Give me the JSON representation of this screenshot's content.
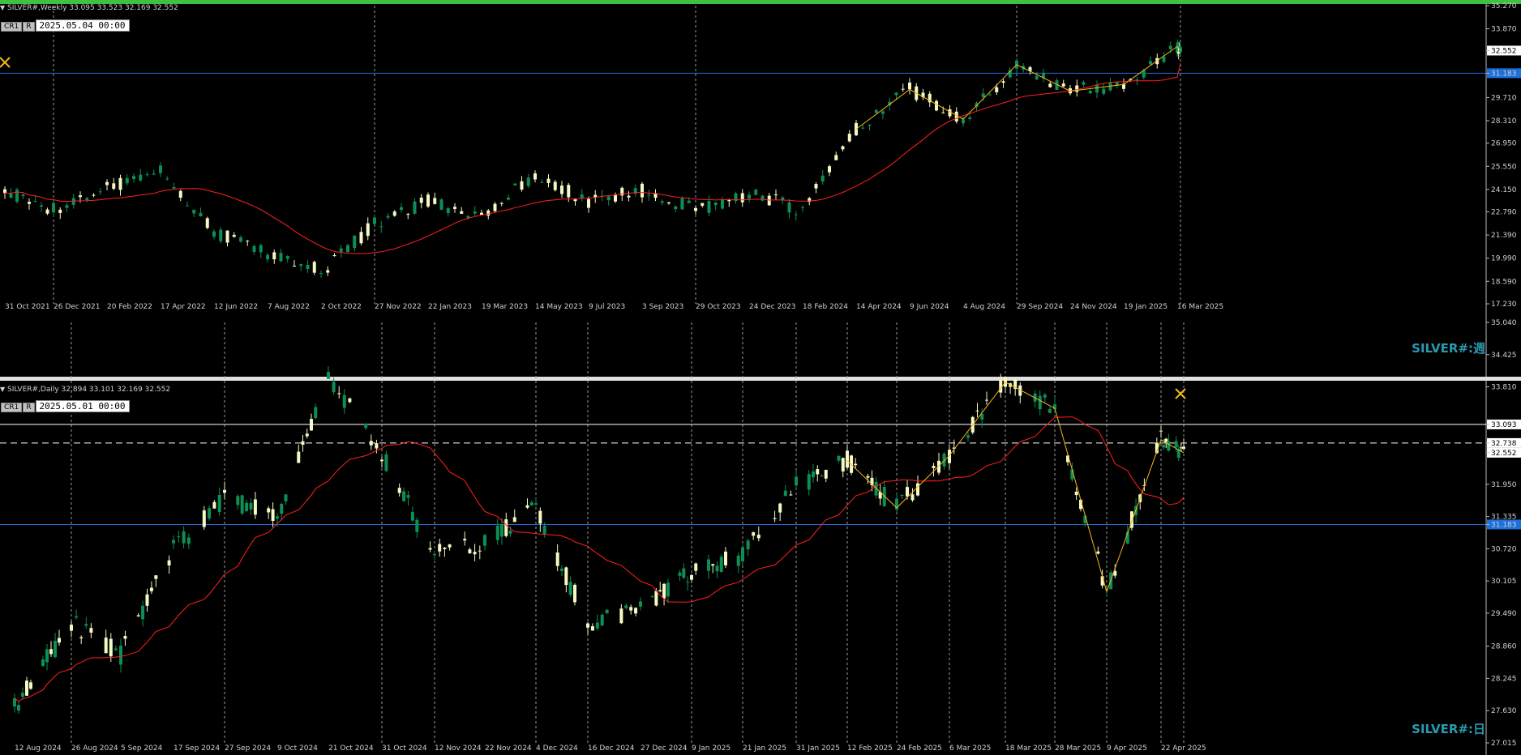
{
  "colors": {
    "background": "#000000",
    "bull": "#0b8f55",
    "bear": "#f4f9c4",
    "ma": "#ff2020",
    "zigzag": "#f2b81a",
    "hline_blue": "#1e6fd9",
    "hline_white": "#ffffff",
    "grid": "#9a9a9a",
    "axis_text": "#d0d0d0",
    "price_tag_blue": "#1e6fd9",
    "watermark": "#2a9bb0",
    "top_bar": "#40c040"
  },
  "weekly": {
    "header": "SILVER#,Weekly  33.095 33.523 32.169 32.552",
    "btn_cr1": "CR1",
    "btn_r": "R",
    "date_box": "2025.05.04 00:00",
    "watermark": "SILVER#:週",
    "price_labels": [
      "35.270",
      "33.870",
      "32.552",
      "31.183",
      "29.710",
      "28.310",
      "26.950",
      "25.550",
      "24.150",
      "22.790",
      "21.390",
      "19.990",
      "18.590",
      "17.230"
    ],
    "date_labels": [
      "31 Oct 2021",
      "26 Dec 2021",
      "20 Feb 2022",
      "17 Apr 2022",
      "12 Jun 2022",
      "7 Aug 2022",
      "2 Oct 2022",
      "27 Nov 2022",
      "22 Jan 2023",
      "19 Mar 2023",
      "14 May 2023",
      "9 Jul 2023",
      "3 Sep 2023",
      "29 Oct 2023",
      "24 Dec 2023",
      "18 Feb 2024",
      "14 Apr 2024",
      "9 Jun 2024",
      "4 Aug 2024",
      "29 Sep 2024",
      "24 Nov 2024",
      "19 Jan 2025",
      "16 Mar 2025"
    ]
  },
  "daily": {
    "header": "SILVER#,Daily  32.894 33.101 32.169 32.552",
    "btn_cr1": "CR1",
    "btn_r": "R",
    "date_box": "2025.05.01 00:00",
    "watermark": "SILVER#:日",
    "price_labels": [
      "35.040",
      "34.425",
      "33.810",
      "33.093",
      "32.738",
      "32.552",
      "31.950",
      "31.335",
      "31.183",
      "30.720",
      "30.105",
      "29.490",
      "28.860",
      "28.245",
      "27.630",
      "27.015"
    ],
    "date_labels": [
      "12 Aug 2024",
      "26 Aug 2024",
      "5 Sep 2024",
      "17 Sep 2024",
      "27 Sep 2024",
      "9 Oct 2024",
      "21 Oct 2024",
      "31 Oct 2024",
      "12 Nov 2024",
      "22 Nov 2024",
      "4 Dec 2024",
      "16 Dec 2024",
      "27 Dec 2024",
      "9 Jan 2025",
      "21 Jan 2025",
      "31 Jan 2025",
      "12 Feb 2025",
      "24 Feb 2025",
      "6 Mar 2025",
      "18 Mar 2025",
      "28 Mar 2025",
      "9 Apr 2025",
      "22 Apr 2025"
    ]
  },
  "chart_data": [
    {
      "type": "candlestick",
      "title": "SILVER#,Weekly",
      "ohlc_last": {
        "open": 33.095,
        "high": 33.523,
        "low": 32.169,
        "close": 32.552
      },
      "ylim": [
        17.23,
        35.27
      ],
      "horizontal_lines": [
        31.183
      ],
      "moving_average": "red line",
      "zigzag": "orange line (recent swings)",
      "anchors": [
        [
          "31 Oct 2021",
          24.0
        ],
        [
          "26 Dec 2021",
          23.0
        ],
        [
          "20 Feb 2022",
          24.3
        ],
        [
          "17 Apr 2022",
          25.3
        ],
        [
          "12 Jun 2022",
          21.6
        ],
        [
          "7 Aug 2022",
          20.2
        ],
        [
          "2 Oct 2022",
          19.2
        ],
        [
          "27 Nov 2022",
          22.0
        ],
        [
          "22 Jan 2023",
          23.5
        ],
        [
          "19 Mar 2023",
          22.6
        ],
        [
          "14 May 2023",
          25.0
        ],
        [
          "9 Jul 2023",
          23.4
        ],
        [
          "3 Sep 2023",
          24.1
        ],
        [
          "29 Oct 2023",
          22.9
        ],
        [
          "24 Dec 2023",
          23.9
        ],
        [
          "18 Feb 2024",
          22.9
        ],
        [
          "14 Apr 2024",
          27.8
        ],
        [
          "9 Jun 2024",
          30.2
        ],
        [
          "4 Aug 2024",
          28.4
        ],
        [
          "29 Sep 2024",
          31.7
        ],
        [
          "24 Nov 2024",
          30.1
        ],
        [
          "19 Jan 2025",
          30.5
        ],
        [
          "16 Mar 2025",
          32.8
        ],
        [
          "4 May 2025",
          32.552
        ]
      ]
    },
    {
      "type": "candlestick",
      "title": "SILVER#,Daily",
      "ohlc_last": {
        "open": 32.894,
        "high": 33.101,
        "low": 32.169,
        "close": 32.552
      },
      "ylim": [
        27.015,
        35.04
      ],
      "horizontal_lines": [
        33.093,
        32.738,
        31.183
      ],
      "moving_average": "red line",
      "zigzag": "orange line (recent swings)",
      "anchors": [
        [
          "12 Aug 2024",
          27.7
        ],
        [
          "26 Aug 2024",
          29.3
        ],
        [
          "5 Sep 2024",
          28.7
        ],
        [
          "17 Sep 2024",
          30.7
        ],
        [
          "27 Sep 2024",
          31.7
        ],
        [
          "9 Oct 2024",
          31.3
        ],
        [
          "21 Oct 2024",
          34.0
        ],
        [
          "31 Oct 2024",
          32.5
        ],
        [
          "12 Nov 2024",
          30.6
        ],
        [
          "22 Nov 2024",
          30.8
        ],
        [
          "4 Dec 2024",
          31.5
        ],
        [
          "16 Dec 2024",
          29.3
        ],
        [
          "27 Dec 2024",
          29.6
        ],
        [
          "9 Jan 2025",
          30.3
        ],
        [
          "21 Jan 2025",
          30.6
        ],
        [
          "31 Jan 2025",
          31.9
        ],
        [
          "12 Feb 2025",
          32.4
        ],
        [
          "24 Feb 2025",
          31.5
        ],
        [
          "6 Mar 2025",
          32.5
        ],
        [
          "18 Mar 2025",
          33.9
        ],
        [
          "28 Mar 2025",
          33.4
        ],
        [
          "9 Apr 2025",
          29.9
        ],
        [
          "22 Apr 2025",
          32.8
        ],
        [
          "1 May 2025",
          32.552
        ]
      ]
    }
  ]
}
